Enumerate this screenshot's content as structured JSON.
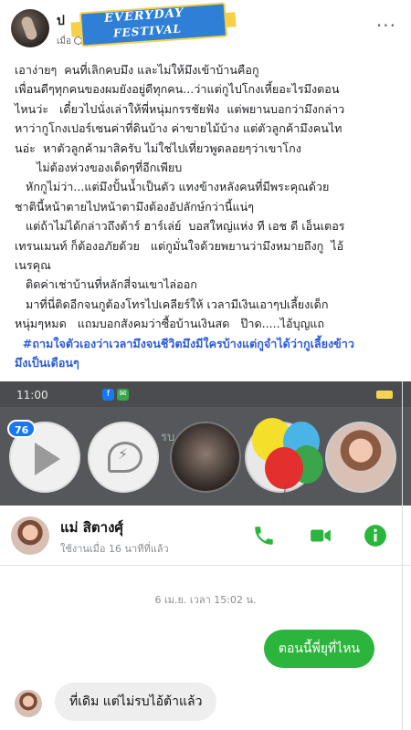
{
  "post": {
    "author": "ป",
    "time": "เมื่อ",
    "banner": {
      "line1": "EVERYDAY",
      "line2": "FESTIVAL"
    },
    "lines": [
      "เอาง่ายๆ  คนที่เลิกคบมึง และไม่ให้มึงเข้าบ้านคือกู",
      "เพื่อนดีๆทุกคนของผมยังอยู่ดีทุกคน...ว่าแต่กูไปโกงเหี้ยอะไรมึงตอน",
      "ไหนว่ะ   เดี๋ยวไปนั่งเล่าให้พี่หนุ่มกรรชัยฟัง  แต่พยานบอกว่ามึงกล่าว",
      "หาว่ากูโกงเปอร์เซนค่าที่ดินบ้าง ค่าขายไม้บ้าง แต่ตัวลูกค้ามึงคนไท",
      "นอ่ะ  หาตัวลูกค้ามาสิครับ ไม่ใช่ไปเที่ยวพูดลอยๆว่าเขาโกง",
      "      ไม่ต้องห่วงของเด็ดๆที่อีกเพียบ",
      "   หักกูไม่ว่า...แต่มึงปั้นน้ำเป็นตัว แทงข้างหลังคนที่มีพระคุณด้วย",
      "ชาตินี้หน้าตายไปหน้าตามึงต้องอัปลักษ์กว่านี้แน่ๆ",
      "   แต่ถ้าไม่ได้กล่าวถึงต้าร์ ฮาร์เล่ย์  บอสใหญ่แห่ง ที เอช ดี เอ็นเตอร",
      "เทรนเมนท์ ก็ต้องอภัยด้วย   แต่กูมั่นใจด้วยพยานว่ามึงหมายถึงกู  ไอ้",
      "เนรคุณ",
      "",
      "   ติดค่าเช่าบ้านที่หลักสี่จนเขาไล่ออก",
      "   มาที่นี่ติดอีกจนกูต้องโทรไปเคลียร์ให้ เวลามีเงินเอาๆปเลี้ยงเด็ก",
      "หนุ่มๆหมด   แถมบอกสังคมว่าซื้อบ้านเงินสด   ป๊าด.....ไอ้บุญแถ"
    ],
    "hashtag_lines": [
      "  #ถามใจตัวเองว่าเวลามึงจนชีวิตมึงมีใครบ้างแต่กูจำได้ว่ากูเลี้ยงข้าว",
      "มึงเป็นเดือนๆ"
    ]
  },
  "screenshot": {
    "status_time": "11:00",
    "dim_text": "รบ",
    "badge_count": "76",
    "chat": {
      "name": "แม่ สิตางศุ์",
      "status": "ใช้งานเมื่อ 16 นาทีที่แล้ว",
      "date": "6 เม.ย. เวลา 15:02 น.",
      "outgoing": "ตอนนี้พี่ยุที่ไหน",
      "incoming": "ที่เดิม แต่ไม่รบไอ้ต้าแล้ว"
    },
    "colors": {
      "accent_green": "#2bb53c",
      "bubble_grey": "#eeeeee",
      "badge_blue": "#1877f2"
    }
  }
}
